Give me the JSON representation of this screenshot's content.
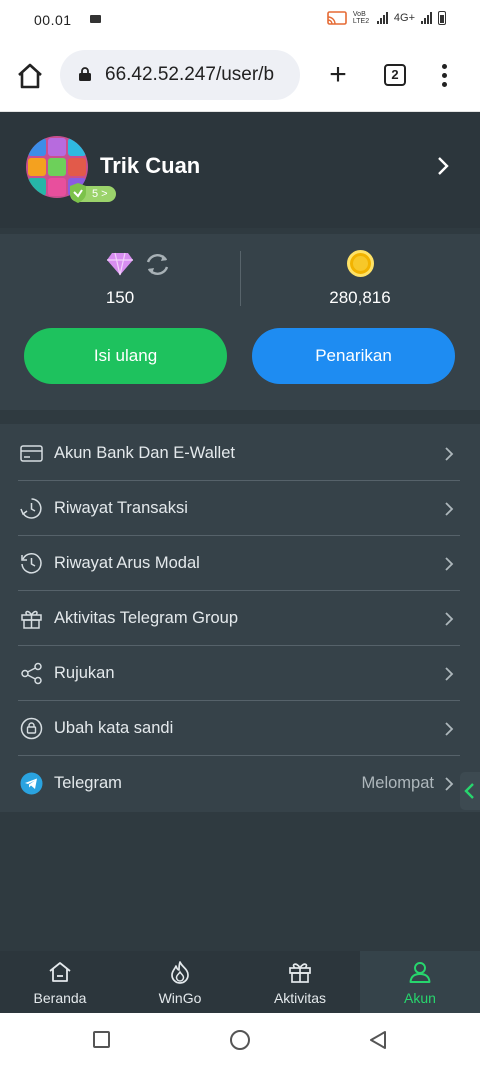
{
  "status_bar": {
    "time": "00.01",
    "network_volte": "VoB LTE2",
    "network_type": "4G+",
    "icons": [
      "cast-icon",
      "signal-icon",
      "signal-icon",
      "battery-icon"
    ]
  },
  "browser": {
    "url": "66.42.52.247/user/b",
    "tab_count": "2",
    "icons": [
      "home-icon",
      "lock-icon",
      "plus-icon",
      "tabs-icon",
      "more-vert-icon"
    ]
  },
  "profile": {
    "username": "Trik Cuan",
    "vip_level": "5 >"
  },
  "wallet": {
    "diamond_value": "150",
    "coin_value": "280,816",
    "topup_label": "Isi ulang",
    "withdraw_label": "Penarikan",
    "colors": {
      "topup": "#1ec25e",
      "withdraw": "#1e8cf2",
      "coin": "#f7c829",
      "diamond": "#d88ef0"
    }
  },
  "menu": {
    "items": [
      {
        "label": "Akun Bank Dan E-Wallet",
        "icon": "bank-card-icon"
      },
      {
        "label": "Riwayat Transaksi",
        "icon": "transaction-history-icon"
      },
      {
        "label": "Riwayat Arus Modal",
        "icon": "history-clock-icon"
      },
      {
        "label": "Aktivitas Telegram Group",
        "icon": "gift-icon"
      },
      {
        "label": "Rujukan",
        "icon": "share-icon"
      },
      {
        "label": "Ubah kata sandi",
        "icon": "lock-settings-icon"
      },
      {
        "label": "Telegram",
        "icon": "telegram-icon",
        "extra": "Melompat"
      }
    ]
  },
  "bottom_nav": {
    "items": [
      {
        "label": "Beranda",
        "icon": "home-icon"
      },
      {
        "label": "WinGo",
        "icon": "flame-icon"
      },
      {
        "label": "Aktivitas",
        "icon": "gift-icon"
      },
      {
        "label": "Akun",
        "icon": "user-icon",
        "active": true
      }
    ],
    "active_color": "#27d66d"
  }
}
